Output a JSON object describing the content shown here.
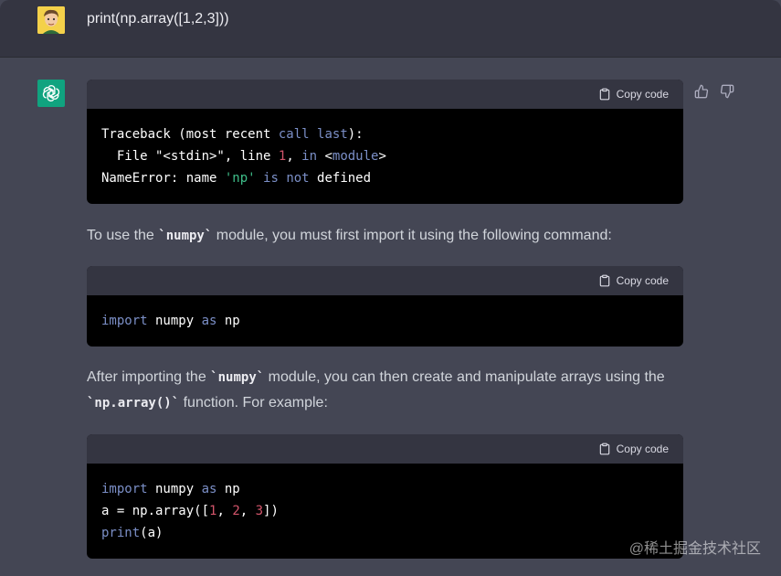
{
  "user_message": {
    "text": "print(np.array([1,2,3]))"
  },
  "code_blocks": {
    "copy_label": "Copy code"
  },
  "block1": {
    "line1_a": "Traceback (most recent ",
    "line1_kw1": "call",
    "line1_b": " ",
    "line1_kw2": "last",
    "line1_c": "):",
    "line2_a": "  File \"<stdin>\", line ",
    "line2_num": "1",
    "line2_b": ", ",
    "line2_kw": "in",
    "line2_c": " <",
    "line2_mod": "module",
    "line2_d": ">",
    "line3_a": "NameError: name ",
    "line3_str": "'np'",
    "line3_b": " ",
    "line3_kw1": "is",
    "line3_c": " ",
    "line3_kw2": "not",
    "line3_d": " defined"
  },
  "para1": {
    "a": "To use the ",
    "code": "`numpy`",
    "b": " module, you must first import it using the following command:"
  },
  "block2": {
    "kw1": "import",
    "a": " numpy ",
    "kw2": "as",
    "b": " np"
  },
  "para2": {
    "a": "After importing the ",
    "code1": "`numpy`",
    "b": " module, you can then create and manipulate arrays using the",
    "code2": "`np.array()`",
    "c": " function. For example:"
  },
  "block3": {
    "l1_kw1": "import",
    "l1_a": " numpy ",
    "l1_kw2": "as",
    "l1_b": " np",
    "l2_a": "a = np.array([",
    "l2_n1": "1",
    "l2_b": ", ",
    "l2_n2": "2",
    "l2_c": ", ",
    "l2_n3": "3",
    "l2_d": "])",
    "l3_kw": "print",
    "l3_a": "(a)"
  },
  "watermark": "@稀土掘金技术社区",
  "colors": {
    "user_bg": "#343541",
    "assistant_bg": "#444654",
    "code_bg": "#000000",
    "accent_green": "#10a37f"
  },
  "icons": {
    "copy": "clipboard-icon",
    "thumbs_up": "thumbs-up-icon",
    "thumbs_down": "thumbs-down-icon",
    "bot": "openai-logo-icon"
  }
}
